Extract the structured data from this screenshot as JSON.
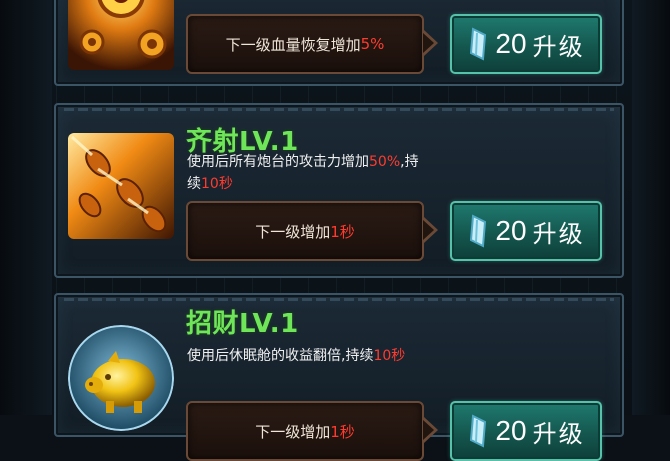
{
  "skills": [
    {
      "icon": "gear-heal-icon",
      "title": "",
      "next": {
        "prefix": "下一级血量恢复增加",
        "highlight": "5%",
        "suffix": ""
      },
      "upgrade": {
        "cost": "20",
        "label": "升级",
        "currency_icon": "crystal-icon"
      }
    },
    {
      "icon": "missiles-icon",
      "title": "齐射LV.1",
      "desc": {
        "line1_a": "使用后所有炮台的攻击力增加",
        "line1_hl": "50%",
        "line1_b": ",持",
        "line2_a": "续",
        "line2_hl": "10秒"
      },
      "next": {
        "prefix": "下一级增加",
        "highlight": "1秒",
        "suffix": ""
      },
      "upgrade": {
        "cost": "20",
        "label": "升级",
        "currency_icon": "crystal-icon"
      }
    },
    {
      "icon": "golden-piggy-bank-icon",
      "title": "招财LV.1",
      "desc": {
        "line1_a": "使用后休眠舱的收益翻倍,持续",
        "line1_hl": "10秒"
      },
      "next": {
        "prefix": "下一级增加",
        "highlight": "1秒",
        "suffix": ""
      },
      "upgrade": {
        "cost": "20",
        "label": "升级",
        "currency_icon": "crystal-icon"
      }
    }
  ],
  "colors": {
    "title_green": "#6fe65a",
    "highlight_red": "#ff3b2f",
    "button_teal": "#1f7a6f"
  }
}
